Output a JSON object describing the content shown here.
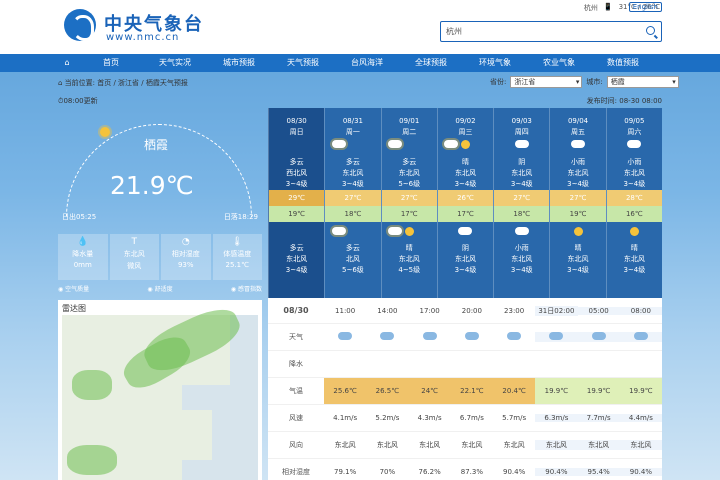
{
  "header": {
    "logo_cn": "中央气象台",
    "logo_en": "www.nmc.cn",
    "toplinks": [
      "杭州",
      "📱",
      "31°C / 26°C"
    ],
    "english": "English",
    "search_value": "杭州"
  },
  "nav": [
    "⌂",
    "首页",
    "天气实况",
    "城市预报",
    "天气预报",
    "台风海洋",
    "全球预报",
    "环境气象",
    "农业气象",
    "数值预报"
  ],
  "breadcrumb": "⌂ 当前位置: 首页 / 浙江省 / 栖霞天气预报",
  "selects": {
    "province_label": "省份:",
    "province": "浙江省",
    "city_label": "城市:",
    "city": "栖霞"
  },
  "update_time": "⏱08:00更新",
  "publish": "发布时间: 08-30 08:00",
  "now": {
    "station": "栖霞",
    "temp": "21.9℃",
    "sunrise": "日出05:25",
    "sunset": "日落18:29"
  },
  "obs": [
    {
      "icon": "💧",
      "label": "降水量",
      "value": "0mm"
    },
    {
      "icon": "T",
      "label": "东北风",
      "value": "微风"
    },
    {
      "icon": "◔",
      "label": "相对湿度",
      "value": "93%"
    },
    {
      "icon": "🌡",
      "label": "体感温度",
      "value": "25.1℃"
    }
  ],
  "alerts": [
    "◉ 空气质量",
    "◉ 舒适度",
    "◉ 感冒指数"
  ],
  "radar_title": "雷达图",
  "days": [
    {
      "date": "08/30",
      "week": "周日",
      "w1": "多云",
      "wd1": "西北风",
      "wl1": "3~4级",
      "hi": "29℃",
      "lo": "19℃",
      "w2": "多云",
      "wd2": "东北风",
      "wl2": "3~4级"
    },
    {
      "date": "08/31",
      "week": "周一",
      "w1": "多云",
      "wd1": "东北风",
      "wl1": "3~4级",
      "hi": "27℃",
      "lo": "18℃",
      "w2": "多云",
      "wd2": "北风",
      "wl2": "5~6级"
    },
    {
      "date": "09/01",
      "week": "周二",
      "w1": "多云",
      "wd1": "东北风",
      "wl1": "5~6级",
      "hi": "27℃",
      "lo": "17℃",
      "w2": "晴",
      "wd2": "东北风",
      "wl2": "4~5级"
    },
    {
      "date": "09/02",
      "week": "周三",
      "w1": "晴",
      "wd1": "东北风",
      "wl1": "3~4级",
      "hi": "26℃",
      "lo": "17℃",
      "w2": "阴",
      "wd2": "东北风",
      "wl2": "3~4级"
    },
    {
      "date": "09/03",
      "week": "周四",
      "w1": "阴",
      "wd1": "东北风",
      "wl1": "3~4级",
      "hi": "27℃",
      "lo": "18℃",
      "w2": "小雨",
      "wd2": "东北风",
      "wl2": "3~4级"
    },
    {
      "date": "09/04",
      "week": "周五",
      "w1": "小雨",
      "wd1": "东北风",
      "wl1": "3~4级",
      "hi": "27℃",
      "lo": "19℃",
      "w2": "晴",
      "wd2": "东北风",
      "wl2": "3~4级"
    },
    {
      "date": "09/05",
      "week": "周六",
      "w1": "小雨",
      "wd1": "东北风",
      "wl1": "3~4级",
      "hi": "28℃",
      "lo": "16℃",
      "w2": "晴",
      "wd2": "东北风",
      "wl2": "3~4级"
    }
  ],
  "hourly": {
    "day": "08/30",
    "weather_label": "天气",
    "rain_label": "降水",
    "temp_label": "气温",
    "wind_speed_label": "风速",
    "wind_dir_label": "风向",
    "humidity_label": "相对湿度",
    "times": [
      "11:00",
      "14:00",
      "17:00",
      "20:00",
      "23:00",
      "31日02:00",
      "05:00",
      "08:00"
    ],
    "temps": [
      "25.6℃",
      "26.5℃",
      "24℃",
      "22.1℃",
      "20.4℃",
      "19.9℃",
      "19.9℃",
      "19.9℃"
    ],
    "speeds": [
      "4.1m/s",
      "5.2m/s",
      "4.3m/s",
      "6.7m/s",
      "5.7m/s",
      "6.3m/s",
      "7.7m/s",
      "4.4m/s"
    ],
    "dirs": [
      "东北风",
      "东北风",
      "东北风",
      "东北风",
      "东北风",
      "东北风",
      "东北风",
      "东北风"
    ],
    "hum": [
      "79.1%",
      "70%",
      "76.2%",
      "87.3%",
      "90.4%",
      "90.4%",
      "95.4%",
      "90.4%"
    ]
  }
}
